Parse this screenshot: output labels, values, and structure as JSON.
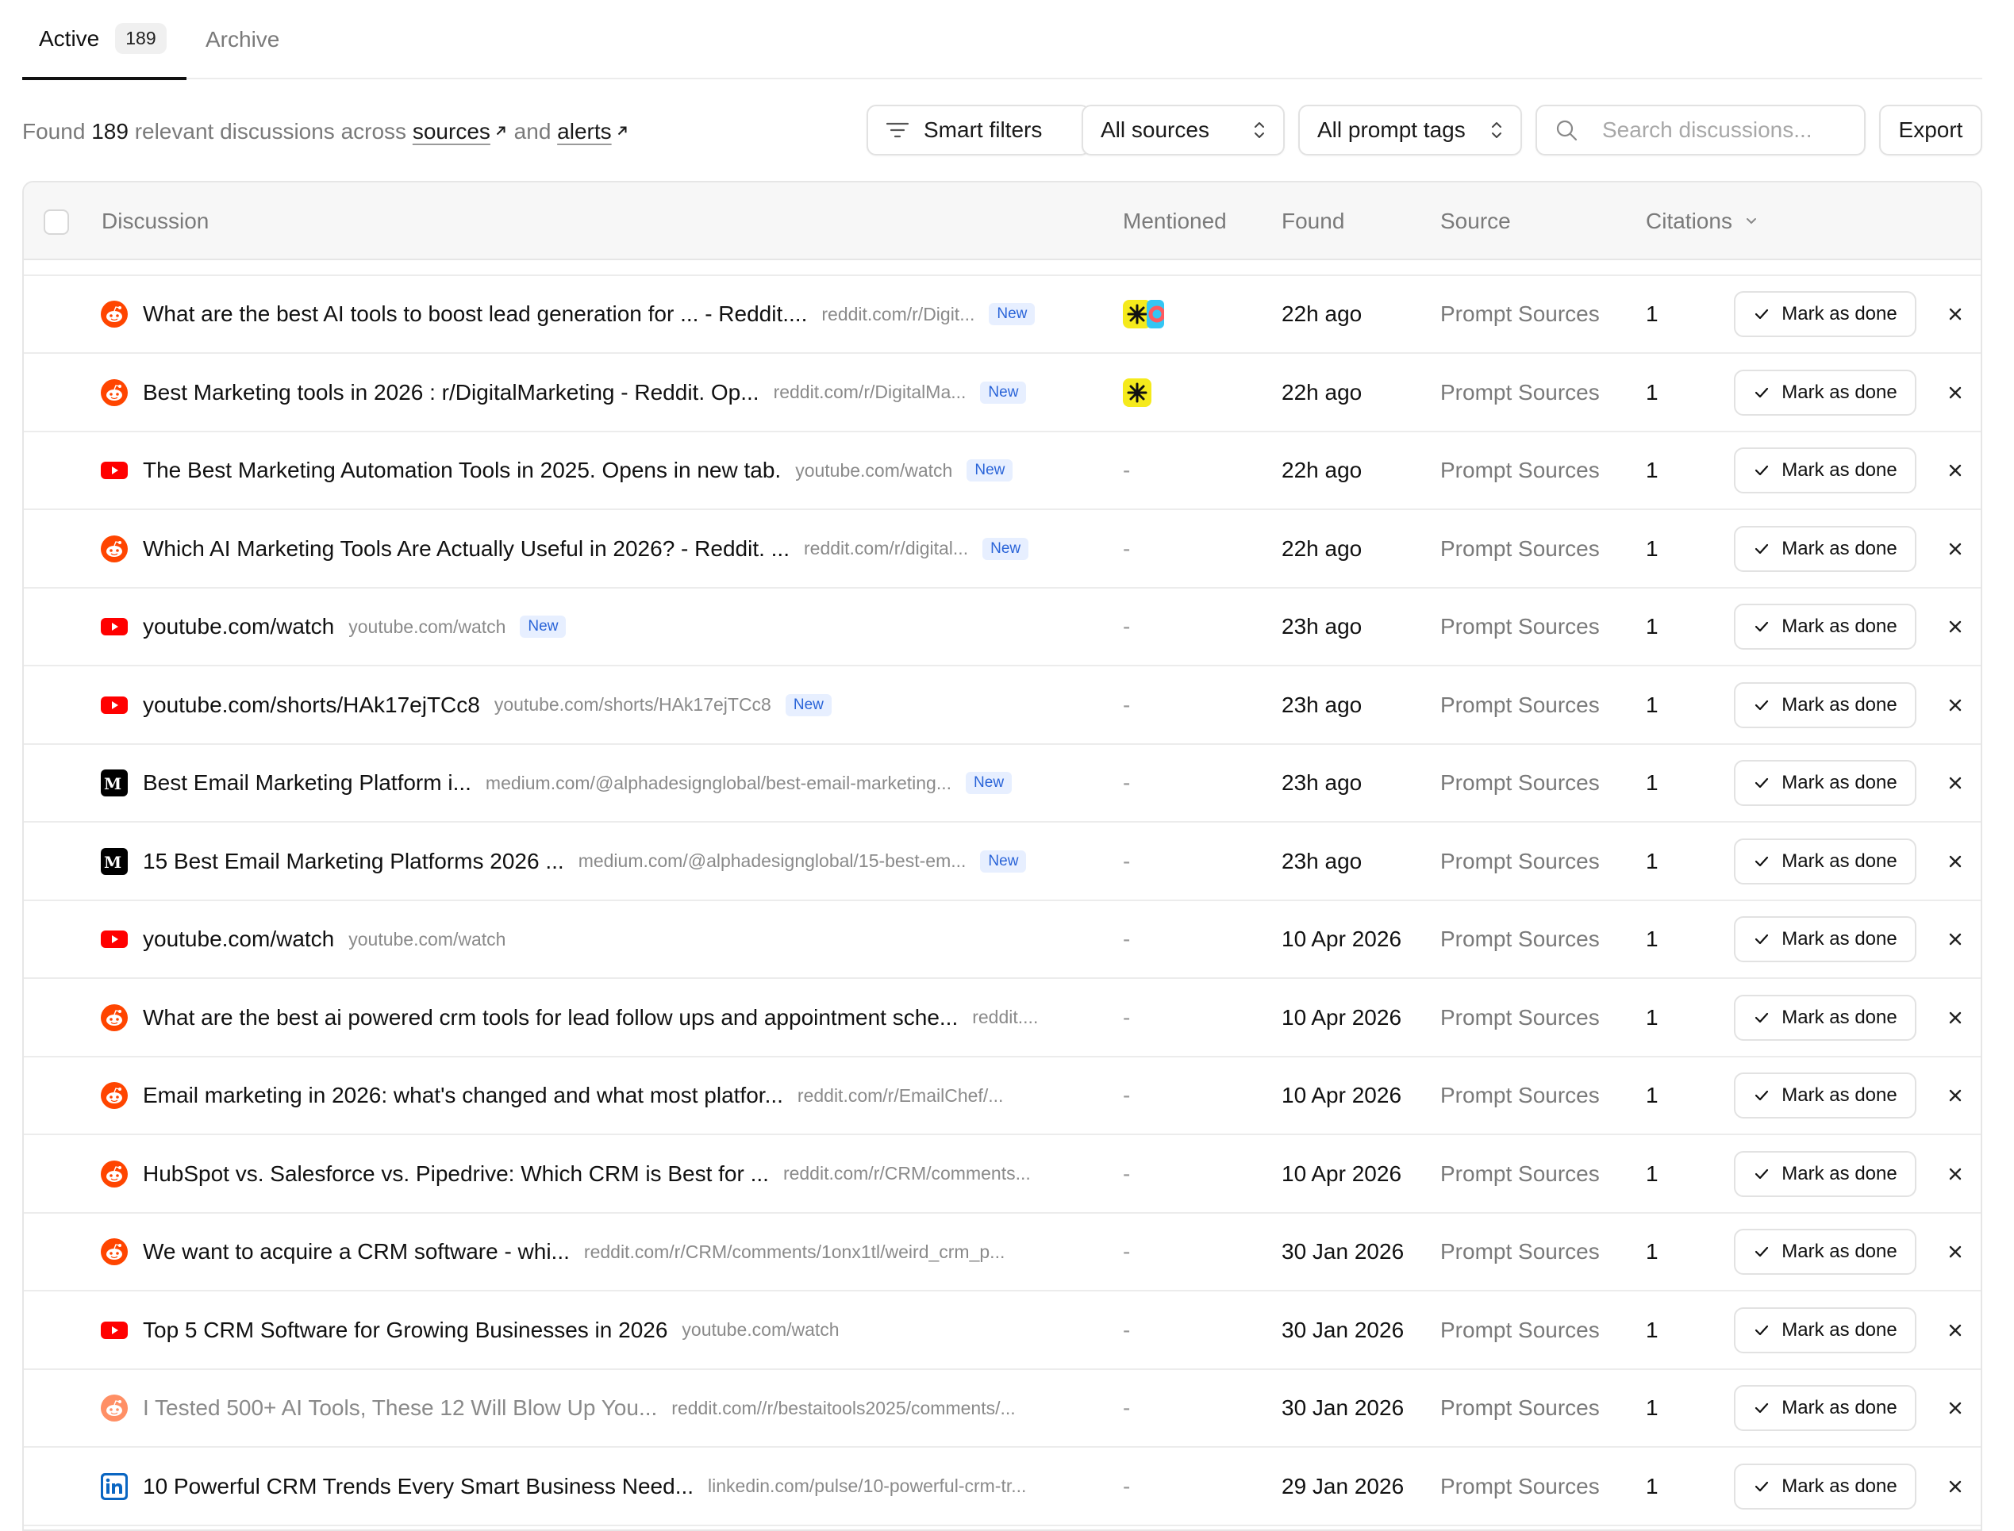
{
  "tabs": {
    "active_label": "Active",
    "active_count": "189",
    "archive_label": "Archive"
  },
  "toolbar": {
    "found_prefix": "Found",
    "found_count": "189",
    "found_middle": "relevant discussions across",
    "sources_link": "sources",
    "and_text": "and",
    "alerts_link": "alerts",
    "smart_filters": "Smart filters",
    "all_sources": "All sources",
    "all_prompt_tags": "All prompt tags",
    "search_placeholder": "Search discussions...",
    "export": "Export"
  },
  "table": {
    "headers": {
      "discussion": "Discussion",
      "mentioned": "Mentioned",
      "found": "Found",
      "source": "Source",
      "citations": "Citations"
    },
    "mark_done_label": "Mark as done",
    "new_label": "New",
    "rows": [
      {
        "icon": "reddit-icon",
        "title": "What are the best AI tools to boost lead generation for ... - Reddit....",
        "url": "reddit.com/r/Digit...",
        "is_new": true,
        "mentioned": [
          "asterisk-logo",
          "ring-logo"
        ],
        "found": "22h ago",
        "source": "Prompt Sources",
        "citations": "1"
      },
      {
        "icon": "reddit-icon",
        "title": "Best Marketing tools in 2026 : r/DigitalMarketing - Reddit. Op...",
        "url": "reddit.com/r/DigitalMa...",
        "is_new": true,
        "mentioned": [
          "asterisk-logo"
        ],
        "found": "22h ago",
        "source": "Prompt Sources",
        "citations": "1"
      },
      {
        "icon": "youtube-icon",
        "title": "The Best Marketing Automation Tools in 2025. Opens in new tab.",
        "url": "youtube.com/watch",
        "is_new": true,
        "mentioned": [],
        "mentioned_text": "-",
        "found": "22h ago",
        "source": "Prompt Sources",
        "citations": "1"
      },
      {
        "icon": "reddit-icon",
        "title": "Which AI Marketing Tools Are Actually Useful in 2026? - Reddit. ...",
        "url": "reddit.com/r/digital...",
        "is_new": true,
        "mentioned": [],
        "mentioned_text": "-",
        "found": "22h ago",
        "source": "Prompt Sources",
        "citations": "1"
      },
      {
        "icon": "youtube-icon",
        "title": "youtube.com/watch",
        "url": "youtube.com/watch",
        "is_new": true,
        "mentioned": [],
        "mentioned_text": "-",
        "found": "23h ago",
        "source": "Prompt Sources",
        "citations": "1"
      },
      {
        "icon": "youtube-icon",
        "title": "youtube.com/shorts/HAk17ejTCc8",
        "url": "youtube.com/shorts/HAk17ejTCc8",
        "is_new": true,
        "mentioned": [],
        "mentioned_text": "-",
        "found": "23h ago",
        "source": "Prompt Sources",
        "citations": "1"
      },
      {
        "icon": "medium-icon",
        "title": "Best Email Marketing Platform i...",
        "url": "medium.com/@alphadesignglobal/best-email-marketing...",
        "is_new": true,
        "mentioned": [],
        "mentioned_text": "-",
        "found": "23h ago",
        "source": "Prompt Sources",
        "citations": "1"
      },
      {
        "icon": "medium-icon",
        "title": "15 Best Email Marketing Platforms 2026 ...",
        "url": "medium.com/@alphadesignglobal/15-best-em...",
        "is_new": true,
        "mentioned": [],
        "mentioned_text": "-",
        "found": "23h ago",
        "source": "Prompt Sources",
        "citations": "1"
      },
      {
        "icon": "youtube-icon",
        "title": "youtube.com/watch",
        "url": "youtube.com/watch",
        "is_new": false,
        "mentioned": [],
        "mentioned_text": "-",
        "found": "10 Apr 2026",
        "source": "Prompt Sources",
        "citations": "1"
      },
      {
        "icon": "reddit-icon",
        "title": "What are the best ai powered crm tools for lead follow ups and appointment sche...",
        "url": "reddit....",
        "is_new": false,
        "mentioned": [],
        "mentioned_text": "-",
        "found": "10 Apr 2026",
        "source": "Prompt Sources",
        "citations": "1"
      },
      {
        "icon": "reddit-icon",
        "title": "Email marketing in 2026: what's changed and what most platfor...",
        "url": "reddit.com/r/EmailChef/...",
        "is_new": false,
        "mentioned": [],
        "mentioned_text": "-",
        "found": "10 Apr 2026",
        "source": "Prompt Sources",
        "citations": "1"
      },
      {
        "icon": "reddit-icon",
        "title": "HubSpot vs. Salesforce vs. Pipedrive: Which CRM is Best for ...",
        "url": "reddit.com/r/CRM/comments...",
        "is_new": false,
        "mentioned": [],
        "mentioned_text": "-",
        "found": "10 Apr 2026",
        "source": "Prompt Sources",
        "citations": "1"
      },
      {
        "icon": "reddit-icon",
        "title": "We want to acquire a CRM software - whi...",
        "url": "reddit.com/r/CRM/comments/1onx1tl/weird_crm_p...",
        "is_new": false,
        "mentioned": [],
        "mentioned_text": "-",
        "found": "30 Jan 2026",
        "source": "Prompt Sources",
        "citations": "1"
      },
      {
        "icon": "youtube-icon",
        "title": "Top 5 CRM Software for Growing Businesses in 2026",
        "url": "youtube.com/watch",
        "is_new": false,
        "mentioned": [],
        "mentioned_text": "-",
        "found": "30 Jan 2026",
        "source": "Prompt Sources",
        "citations": "1"
      },
      {
        "icon": "reddit-icon",
        "title": "I Tested 500+ AI Tools, These 12 Will Blow Up You...",
        "url": "reddit.com//r/bestaitools2025/comments/...",
        "is_new": false,
        "faded": true,
        "mentioned": [],
        "mentioned_text": "-",
        "found": "30 Jan 2026",
        "source": "Prompt Sources",
        "citations": "1"
      },
      {
        "icon": "linkedin-icon",
        "title": "10 Powerful CRM Trends Every Smart Business Need...",
        "url": "linkedin.com/pulse/10-powerful-crm-tr...",
        "is_new": false,
        "mentioned": [],
        "mentioned_text": "-",
        "found": "29 Jan 2026",
        "source": "Prompt Sources",
        "citations": "1"
      }
    ]
  },
  "colors": {
    "reddit": "#ff4500",
    "youtube": "#ff0000",
    "linkedin": "#0a66c2",
    "medium": "#000000",
    "new_badge_text": "#2a64d8",
    "new_badge_bg": "#e7efff",
    "asterisk_logo_bg": "#f5ea1c",
    "ring_logo_a": "#ff5a5f",
    "ring_logo_b": "#34c6f4"
  }
}
